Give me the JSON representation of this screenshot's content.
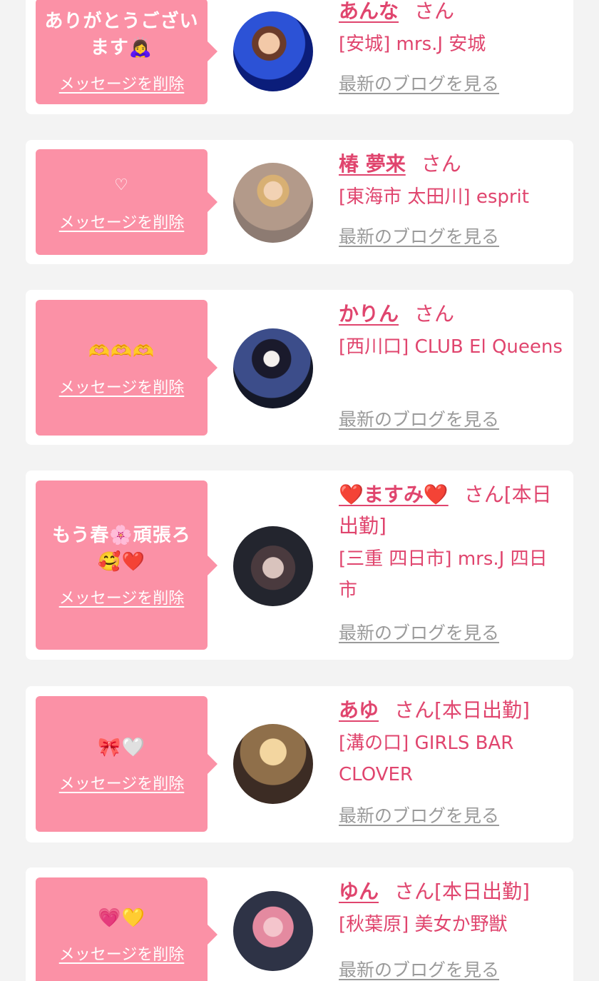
{
  "entries": [
    {
      "message": "ありがとうございます🙇‍♀️",
      "delete_label": "メッセージを削除",
      "name": "あんな",
      "honorific": "さん",
      "shop": "[安城] mrs.J 安城",
      "blog_label": "最新のブログを見る"
    },
    {
      "message": "♡",
      "delete_label": "メッセージを削除",
      "name": "椿 夢来",
      "honorific": "さん",
      "shop": "[東海市 太田川] esprit",
      "blog_label": "最新のブログを見る"
    },
    {
      "message": "🫶🫶🫶",
      "delete_label": "メッセージを削除",
      "name": "かりん",
      "honorific": "さん",
      "shop": "[西川口] CLUB El Queens",
      "blog_label": "最新のブログを見る"
    },
    {
      "message": "もう春🌸頑張ろ🥰❤️",
      "delete_label": "メッセージを削除",
      "name": "❤️ますみ❤️",
      "honorific": "さん[本日出勤]",
      "shop": "[三重 四日市] mrs.J 四日市",
      "blog_label": "最新のブログを見る"
    },
    {
      "message": "🎀🤍",
      "delete_label": "メッセージを削除",
      "name": "あゆ",
      "honorific": "さん[本日出勤]",
      "shop": "[溝の口] GIRLS BAR CLOVER",
      "blog_label": "最新のブログを見る"
    },
    {
      "message": "💗💛",
      "delete_label": "メッセージを削除",
      "name": "ゆん",
      "honorific": "さん[本日出勤]",
      "shop": "[秋葉原] 美女か野獣",
      "blog_label": "最新のブログを見る"
    }
  ],
  "colors": {
    "bubble": "#fb91a6",
    "accent": "#e0456e",
    "muted_link": "#9a9a9a",
    "background": "#f3f3f3"
  }
}
